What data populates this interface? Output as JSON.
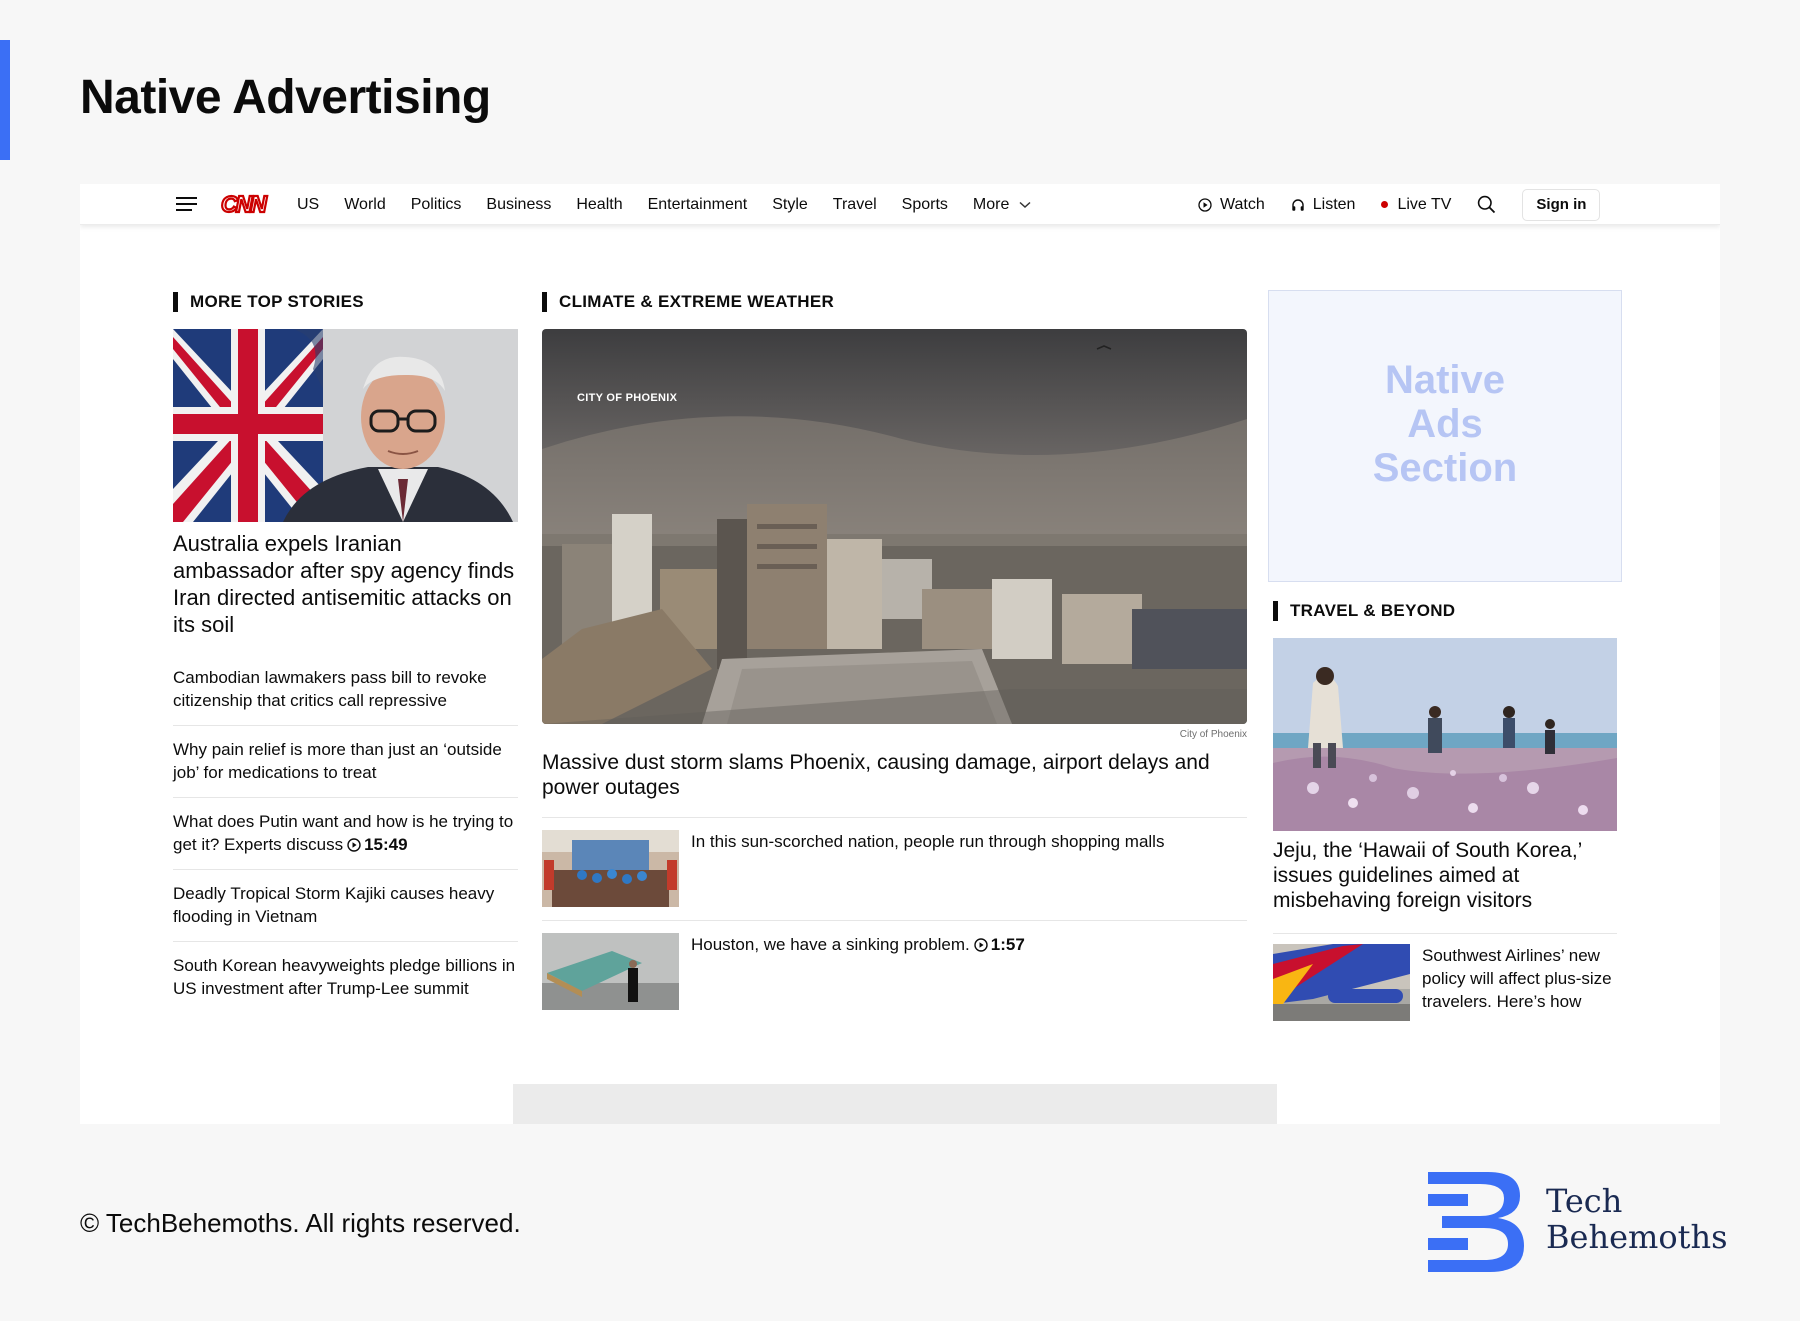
{
  "page": {
    "title": "Native Advertising",
    "copyright": "© TechBehemoths. All rights reserved.",
    "brand": {
      "line1": "Tech",
      "line2": "Behemoths"
    }
  },
  "colors": {
    "accent": "#3b6ff5",
    "cnn_red": "#cc0000",
    "ad_text": "#b6c5f4",
    "brand_blue": "#3b6ff5"
  },
  "nav": {
    "logo": "CNN",
    "links": [
      "US",
      "World",
      "Politics",
      "Business",
      "Health",
      "Entertainment",
      "Style",
      "Travel",
      "Sports"
    ],
    "more": "More",
    "watch": "Watch",
    "listen": "Listen",
    "live_tv": "Live TV",
    "sign_in": "Sign in"
  },
  "left": {
    "header": "MORE TOP STORIES",
    "lead_title": "Australia expels Iranian ambassador after spy agency finds Iran directed antisemitic attacks on its soil",
    "stories": [
      {
        "text": "Cambodian lawmakers pass bill to revoke citizenship that critics call repressive",
        "duration": ""
      },
      {
        "text": "Why pain relief is more than just an ‘outside job’ for medications to treat",
        "duration": ""
      },
      {
        "text": "What does Putin want and how is he trying to get it? Experts discuss",
        "duration": "15:49"
      },
      {
        "text": "Deadly Tropical Storm Kajiki causes heavy flooding in Vietnam",
        "duration": ""
      },
      {
        "text": "South Korean heavyweights pledge billions in US investment after Trump-Lee summit",
        "duration": ""
      }
    ]
  },
  "center": {
    "header": "CLIMATE & EXTREME WEATHER",
    "hero_label": "CITY OF PHOENIX",
    "hero_credit": "City of Phoenix",
    "hero_title": "Massive dust storm slams Phoenix, causing damage, airport delays and power outages",
    "rows": [
      {
        "text": "In this sun-scorched nation, people run through shopping malls",
        "duration": ""
      },
      {
        "text": "Houston, we have a sinking problem.",
        "duration": "1:57"
      }
    ]
  },
  "right": {
    "ad_line1": "Native",
    "ad_line2": "Ads",
    "ad_line3": "Section",
    "header": "TRAVEL & BEYOND",
    "lead_title": "Jeju, the ‘Hawaii of South Korea,’ issues guidelines aimed at misbehaving foreign visitors",
    "row_text": "Southwest Airlines’ new policy will affect plus-size travelers. Here’s how"
  }
}
